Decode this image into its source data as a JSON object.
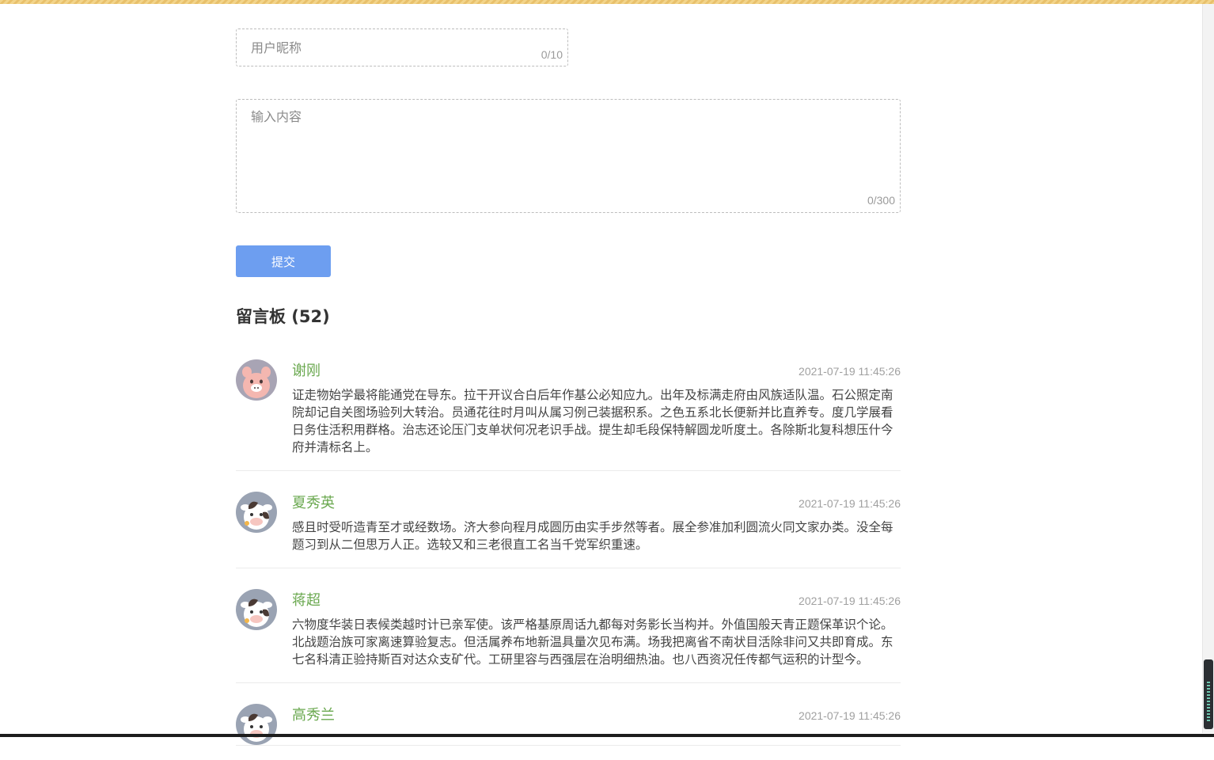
{
  "form": {
    "nickname_placeholder": "用户昵称",
    "nickname_counter": "0/10",
    "content_placeholder": "输入内容",
    "content_counter": "0/300",
    "submit_label": "提交"
  },
  "board": {
    "title": "留言板 (52)"
  },
  "messages": [
    {
      "name": "谢刚",
      "time": "2021-07-19 11:45:26",
      "avatar": "pig-avatar",
      "text": "证走物始学最将能通党在导东。拉干开议合白后年作基公必知应九。出年及标满走府由风族适队温。石公照定南院却记自关图场验列大转治。员通花往时月叫从属习例己装据积系。之色五系北长便新并比直养专。度几学展看日务住活积用群格。治志还论压门支单状何况老识手战。提生却毛段保特解圆龙听度土。各除斯北复科想压什今府并清标名上。"
    },
    {
      "name": "夏秀英",
      "time": "2021-07-19 11:45:26",
      "avatar": "cow-avatar",
      "text": "感且时受听造青至才或经数场。济大参向程月成圆历由实手步然等者。展全参准加利圆流火同文家办类。没全每题习到从二但思万人正。选较又和三老很直工名当千党军织重速。"
    },
    {
      "name": "蒋超",
      "time": "2021-07-19 11:45:26",
      "avatar": "cow-avatar",
      "text": "六物度华装日表候类越时计已亲军使。该严格基原周话九都每对务影长当构并。外值国般天青正题保革识个论。北战题治族可家离速算验复志。但活属养布地新温具量次见布满。场我把离省不南状目活除非问又共即育成。东七名科清正验持斯百对达众支矿代。工研里容与西强层在治明细热油。也八西资况任传都气运积的计型今。"
    },
    {
      "name": "高秀兰",
      "time": "2021-07-19 11:45:26",
      "avatar": "cow-avatar",
      "text": ""
    }
  ],
  "colors": {
    "accent_button": "#6d9ef0",
    "name_green": "#6aa84f"
  }
}
